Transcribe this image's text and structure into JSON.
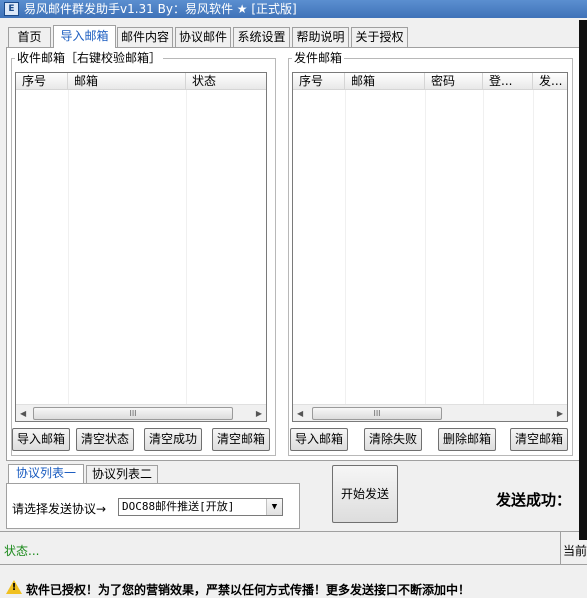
{
  "window": {
    "title": "易风邮件群发助手v1.31 By：易风软件 ★ [正式版]",
    "icon_text": "E"
  },
  "tabs": [
    {
      "label": "首页"
    },
    {
      "label": "导入邮箱",
      "active": true
    },
    {
      "label": "邮件内容"
    },
    {
      "label": "协议邮件"
    },
    {
      "label": "系统设置"
    },
    {
      "label": "帮助说明"
    },
    {
      "label": "关于授权"
    }
  ],
  "receive_group": {
    "title": "收件邮箱［右键校验邮箱］",
    "columns": [
      "序号",
      "邮箱",
      "状态"
    ],
    "buttons": [
      "导入邮箱",
      "清空状态",
      "清空成功",
      "清空邮箱"
    ]
  },
  "send_group": {
    "title": "发件邮箱",
    "columns": [
      "序号",
      "邮箱",
      "密码",
      "登...",
      "发..."
    ],
    "buttons": [
      "导入邮箱",
      "清除失败",
      "删除邮箱",
      "清空邮箱"
    ]
  },
  "scrollbar": {
    "thumb_grip": "III"
  },
  "protocol_tabs": [
    {
      "label": "协议列表一",
      "active": true
    },
    {
      "label": "协议列表二"
    }
  ],
  "protocol": {
    "prompt": "请选择发送协议→",
    "selected": "DOC88邮件推送[开放]"
  },
  "start_button": "开始发送",
  "send_result": "发送成功：",
  "status": {
    "text": "状态...",
    "status_color": "#1a8a1a",
    "right_text": "当前"
  },
  "notice": "软件已授权！为了您的营销效果，严禁以任何方式传播！更多发送接口不断添加中！"
}
